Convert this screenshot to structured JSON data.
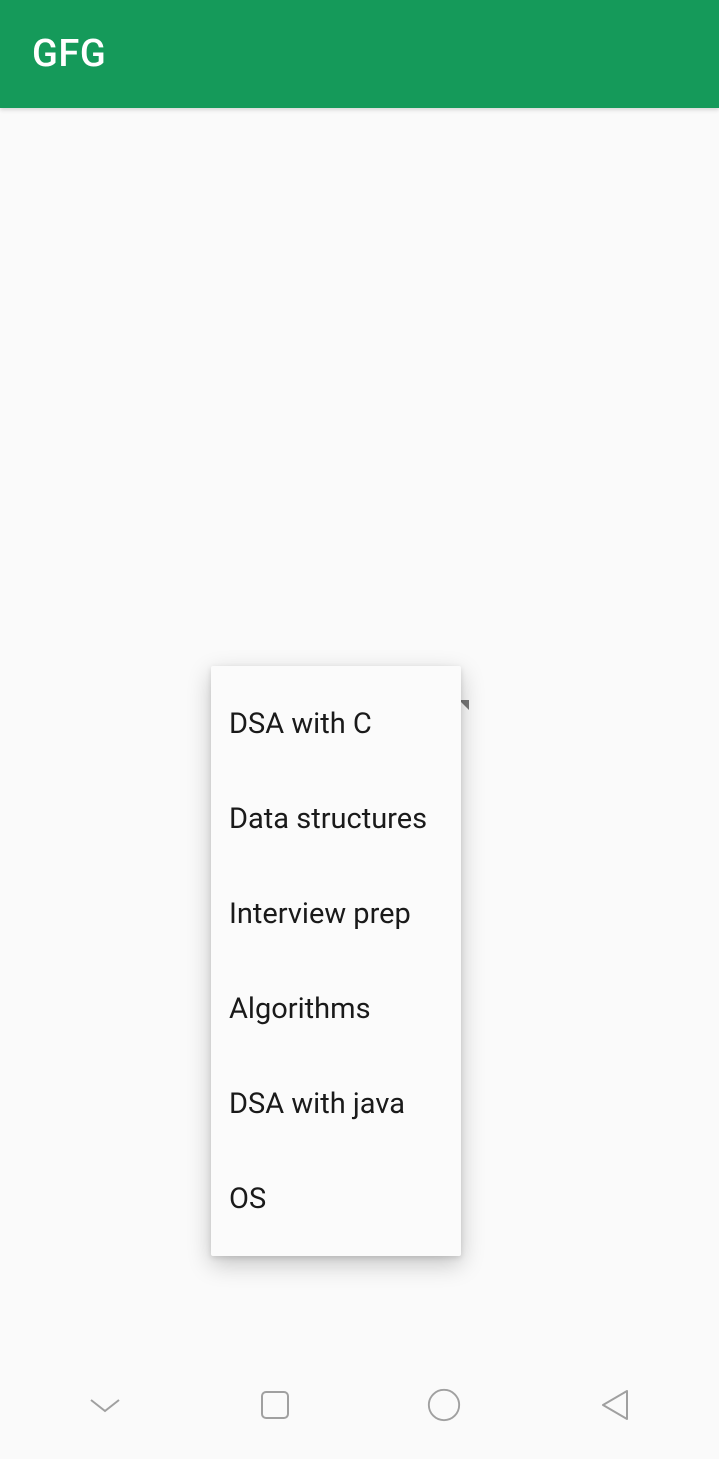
{
  "appBar": {
    "title": "GFG"
  },
  "dropdown": {
    "items": [
      "DSA with C",
      "Data structures",
      "Interview prep",
      "Algorithms",
      "DSA with java",
      "OS"
    ]
  }
}
